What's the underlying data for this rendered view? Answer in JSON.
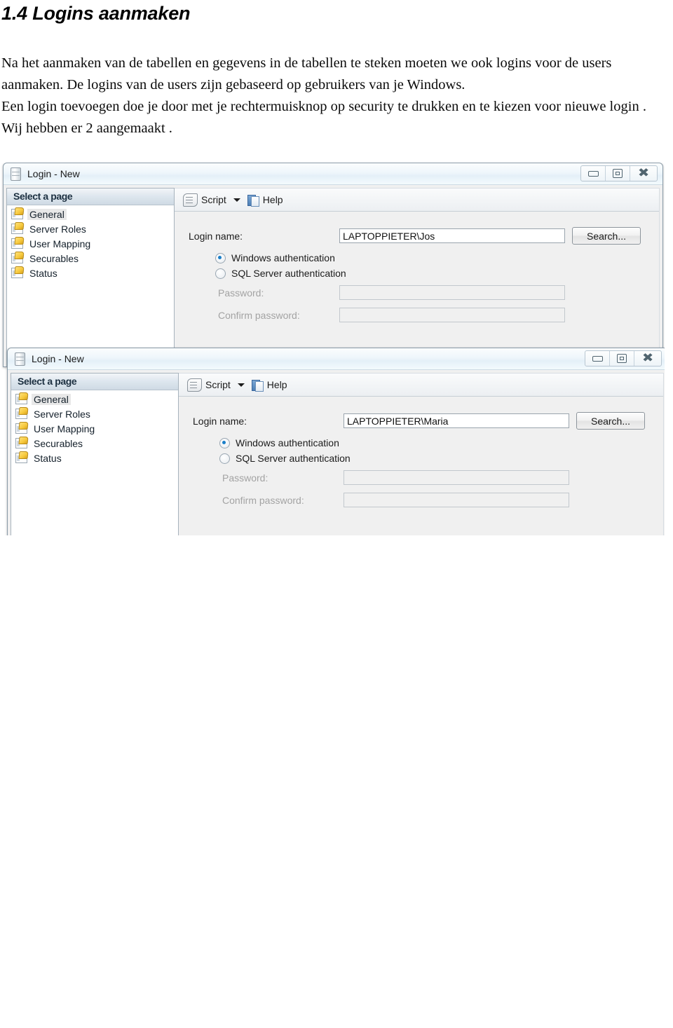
{
  "document": {
    "heading": "1.4 Logins aanmaken",
    "paragraphs": [
      "Na het aanmaken van de tabellen en gegevens in de tabellen te steken moeten we ook logins voor de users aanmaken.  De logins van de  users zijn gebaseerd op gebruikers van je Windows.",
      "Een login toevoegen doe je door met je rechtermuisknop op security te drukken en te kiezen voor nieuwe login . Wij hebben er 2 aangemaakt ."
    ]
  },
  "dialogs": [
    {
      "title": "Login - New",
      "title_icon": "server-icon",
      "window_controls": {
        "minimize": "minimize-icon",
        "restore": "restore-icon",
        "close": "close-icon"
      },
      "sidebar": {
        "header": "Select a page",
        "items": [
          {
            "label": "General",
            "icon": "page-icon",
            "selected": true
          },
          {
            "label": "Server Roles",
            "icon": "page-icon",
            "selected": false
          },
          {
            "label": "User Mapping",
            "icon": "page-icon",
            "selected": false
          },
          {
            "label": "Securables",
            "icon": "page-icon",
            "selected": false
          },
          {
            "label": "Status",
            "icon": "page-icon",
            "selected": false
          }
        ]
      },
      "toolbar": {
        "script_label": "Script",
        "script_icon": "script-icon",
        "dropdown_icon": "chevron-down-icon",
        "help_label": "Help",
        "help_icon": "help-icon"
      },
      "form": {
        "login_name_label": "Login name:",
        "login_name_value": "LAPTOPPIETER\\Jos",
        "search_button": "Search...",
        "windows_auth_label": "Windows authentication",
        "windows_auth_selected": true,
        "sql_auth_label": "SQL Server authentication",
        "sql_auth_selected": false,
        "password_label": "Password:",
        "password_value": "",
        "confirm_password_label": "Confirm password:",
        "confirm_password_value": ""
      }
    },
    {
      "title": "Login - New",
      "title_icon": "server-icon",
      "window_controls": {
        "minimize": "minimize-icon",
        "restore": "restore-icon",
        "close": "close-icon"
      },
      "sidebar": {
        "header": "Select a page",
        "items": [
          {
            "label": "General",
            "icon": "page-icon",
            "selected": true
          },
          {
            "label": "Server Roles",
            "icon": "page-icon",
            "selected": false
          },
          {
            "label": "User Mapping",
            "icon": "page-icon",
            "selected": false
          },
          {
            "label": "Securables",
            "icon": "page-icon",
            "selected": false
          },
          {
            "label": "Status",
            "icon": "page-icon",
            "selected": false
          }
        ]
      },
      "toolbar": {
        "script_label": "Script",
        "script_icon": "script-icon",
        "dropdown_icon": "chevron-down-icon",
        "help_label": "Help",
        "help_icon": "help-icon"
      },
      "form": {
        "login_name_label": "Login name:",
        "login_name_value": "LAPTOPPIETER\\Maria",
        "search_button": "Search...",
        "windows_auth_label": "Windows authentication",
        "windows_auth_selected": true,
        "sql_auth_label": "SQL Server authentication",
        "sql_auth_selected": false,
        "password_label": "Password:",
        "password_value": "",
        "confirm_password_label": "Confirm password:",
        "confirm_password_value": ""
      }
    }
  ],
  "colors": {
    "accent": "#1a7ec8",
    "title_bar": "#eef6fb",
    "pane_header": "#dde6ee",
    "dialog_bg": "#f0f0f0"
  }
}
